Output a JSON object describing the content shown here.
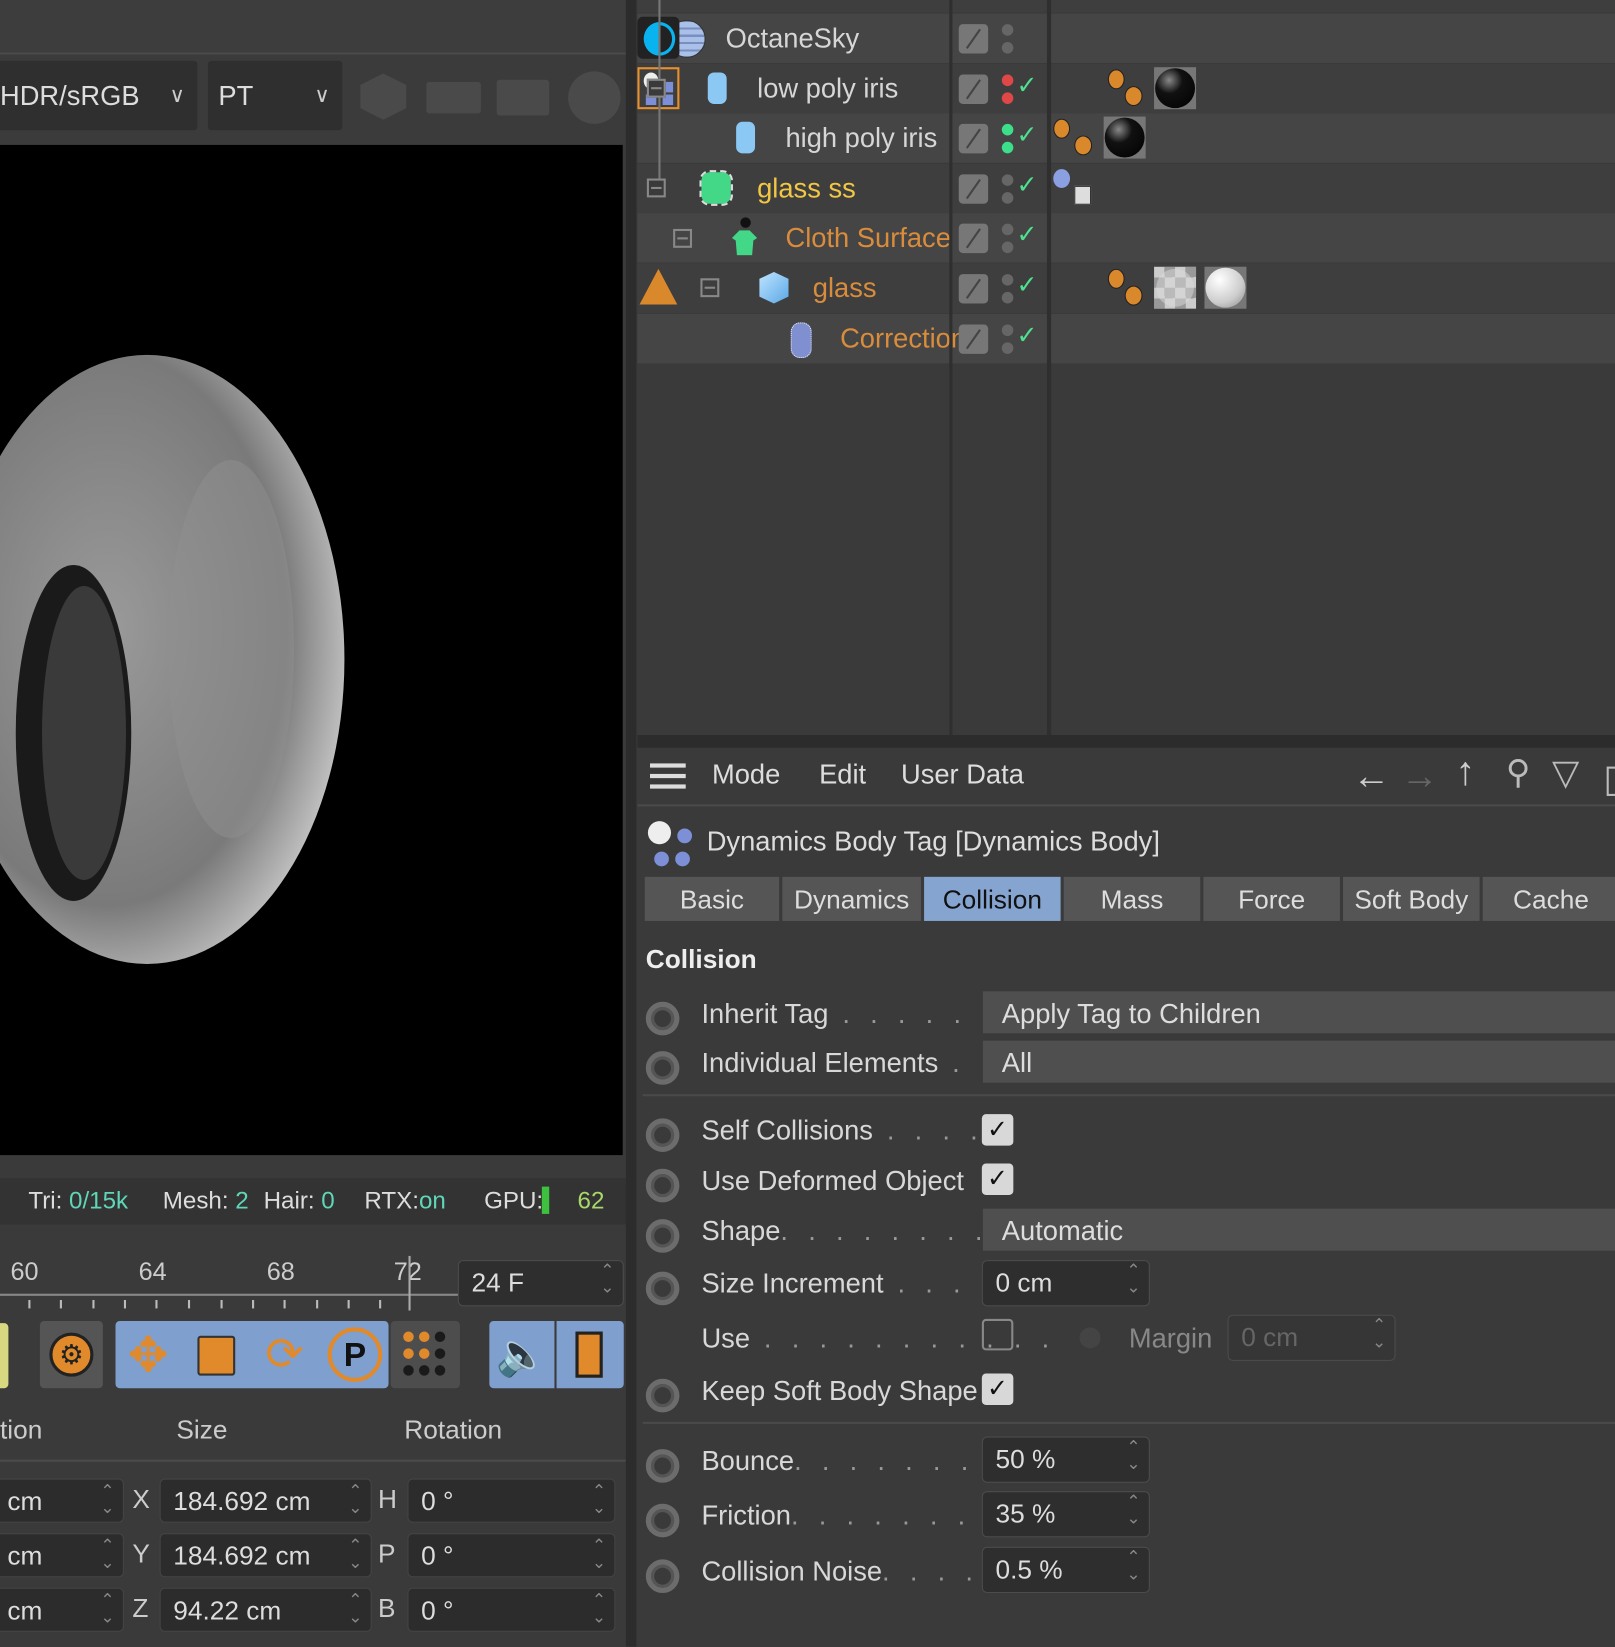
{
  "viewport": {
    "color_space": "HDR/sRGB",
    "render_mode": "PT",
    "status": {
      "tri_label": "Tri:",
      "tri_value": "0/15k",
      "mesh_label": "Mesh:",
      "mesh_value": "2",
      "hair_label": "Hair:",
      "hair_value": "0",
      "rtx_label": "RTX:",
      "rtx_value": "on",
      "gpu_label": "GPU:",
      "gpu_value": "62"
    }
  },
  "timeline": {
    "ticks": [
      "60",
      "64",
      "68",
      "72"
    ],
    "fps": "24 F"
  },
  "coordinates": {
    "headers": [
      "tion",
      "Size",
      "Rotation"
    ],
    "position": [
      "cm",
      "cm",
      "cm"
    ],
    "size_axes": [
      "X",
      "Y",
      "Z"
    ],
    "size": [
      "184.692 cm",
      "184.692 cm",
      "94.22 cm"
    ],
    "rot_axes": [
      "H",
      "P",
      "B"
    ],
    "rotation": [
      "0 °",
      "0 °",
      "0 °"
    ]
  },
  "objects": [
    {
      "name": "OctaneSky",
      "color": "#d6d6d6"
    },
    {
      "name": "low poly iris",
      "color": "#d6d6d6"
    },
    {
      "name": "high poly iris",
      "color": "#d6d6d6"
    },
    {
      "name": "glass ss",
      "color": "#f2c744"
    },
    {
      "name": "Cloth Surface",
      "color": "#d98c3c"
    },
    {
      "name": "glass",
      "color": "#d98c3c"
    },
    {
      "name": "Correction",
      "color": "#d98c3c"
    }
  ],
  "attributes": {
    "menu": [
      "Mode",
      "Edit",
      "User Data"
    ],
    "title": "Dynamics Body Tag [Dynamics Body]",
    "tabs": [
      "Basic",
      "Dynamics",
      "Collision",
      "Mass",
      "Force",
      "Soft Body",
      "Cache"
    ],
    "active_tab": "Collision",
    "section": "Collision",
    "inherit_tag": {
      "label": "Inherit Tag",
      "value": "Apply Tag to Children"
    },
    "individual_elements": {
      "label": "Individual Elements",
      "value": "All"
    },
    "self_collisions": {
      "label": "Self Collisions",
      "checked": true
    },
    "use_deformed": {
      "label": "Use Deformed Object",
      "checked": true
    },
    "shape": {
      "label": "Shape",
      "value": "Automatic"
    },
    "size_increment": {
      "label": "Size Increment",
      "value": "0 cm"
    },
    "use": {
      "label": "Use",
      "checked": false,
      "margin_label": "Margin",
      "margin_value": "0 cm"
    },
    "keep_soft_body": {
      "label": "Keep Soft Body Shape",
      "checked": true
    },
    "bounce": {
      "label": "Bounce",
      "value": "50 %"
    },
    "friction": {
      "label": "Friction",
      "value": "35 %"
    },
    "collision_noise": {
      "label": "Collision Noise",
      "value": "0.5 %"
    }
  }
}
